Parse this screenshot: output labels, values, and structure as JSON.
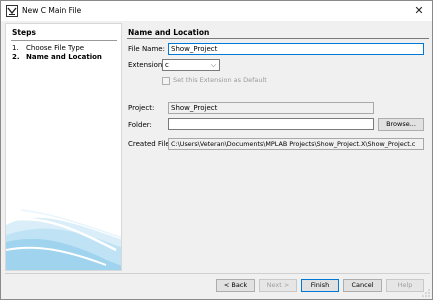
{
  "window": {
    "title": "New C Main File",
    "close_glyph": "✕"
  },
  "steps": {
    "title": "Steps",
    "items": [
      {
        "num": "1.",
        "label": "Choose File Type"
      },
      {
        "num": "2.",
        "label": "Name and Location"
      }
    ]
  },
  "content": {
    "title": "Name and Location",
    "file_name_label": "File Name:",
    "file_name_value": "Show_Project",
    "extension_label": "Extension:",
    "extension_value": "c",
    "default_ext_label": "Set this Extension as Default",
    "project_label": "Project:",
    "project_value": "Show_Project",
    "folder_label": "Folder:",
    "folder_value": "",
    "browse_label": "Browse...",
    "created_file_label": "Created File:",
    "created_file_value": "C:\\Users\\Veteran\\Documents\\MPLAB Projects\\Show_Project.X\\Show_Project.c"
  },
  "buttons": {
    "back": "< Back",
    "next": "Next >",
    "finish": "Finish",
    "cancel": "Cancel",
    "help": "Help"
  },
  "colors": {
    "accent": "#0078d7",
    "art_blue": "#9fd3ee"
  },
  "icons": {
    "app": "mplab-icon",
    "close": "close-icon",
    "dropdown": "chevron-down-icon"
  }
}
